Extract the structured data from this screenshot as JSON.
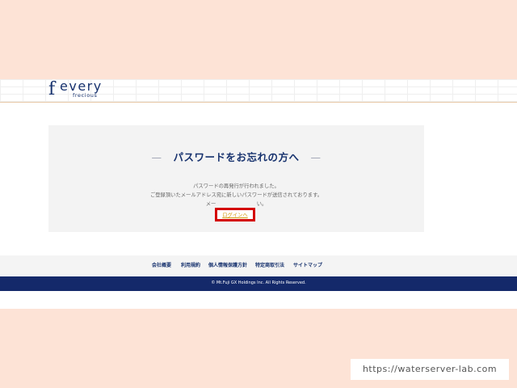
{
  "header": {
    "logo_f": "f",
    "logo_main": "every",
    "logo_sub": "frecious"
  },
  "card": {
    "title": "パスワードをお忘れの方へ",
    "dash": "—",
    "lines": [
      "パスワードの再発行が行われました。",
      "ご登録頂いたメールアドレス宛に新しいパスワードが送信されております。",
      "メー　　　　　　　　い。"
    ],
    "login_link": "ログインへ"
  },
  "footer": {
    "nav": [
      "会社概要",
      "利用規約",
      "個人情報保護方針",
      "特定商取引法",
      "サイトマップ"
    ],
    "copyright": "© Mt.Fuji GX Holdings Inc. All Rights Reserved."
  },
  "watermark": "https://waterserver-lab.com",
  "colors": {
    "brand_navy": "#17326e",
    "footer_bar": "#14296a",
    "highlight_red": "#d40000",
    "link_gold": "#d4960a",
    "page_bg": "#fde3d6"
  }
}
